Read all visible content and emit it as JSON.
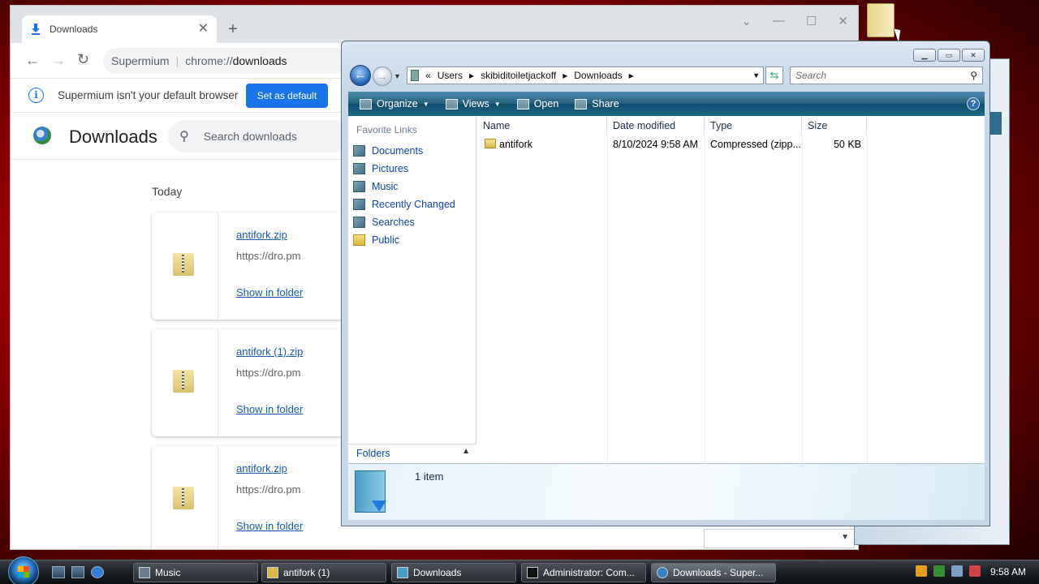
{
  "browser": {
    "tab_title": "Downloads",
    "omnibox_site": "Supermium",
    "omnibox_url_scheme": "chrome://",
    "omnibox_url_host": "downloads",
    "infobar_text": "Supermium isn't your default browser",
    "set_default_label": "Set as default",
    "page_title": "Downloads",
    "search_placeholder": "Search downloads",
    "section_today": "Today",
    "downloads": [
      {
        "file": "antifork.zip",
        "source": "https://dro.pm",
        "action": "Show in folder"
      },
      {
        "file": "antifork (1).zip",
        "source": "https://dro.pm",
        "action": "Show in folder"
      },
      {
        "file": "antifork.zip",
        "source": "https://dro.pm",
        "action": "Show in folder"
      }
    ]
  },
  "explorer": {
    "breadcrumb": {
      "prefix": "«",
      "parts": [
        "Users",
        "skibiditoiletjackoff",
        "Downloads"
      ]
    },
    "search_placeholder": "Search",
    "toolbar": {
      "organize": "Organize",
      "views": "Views",
      "open": "Open",
      "share": "Share",
      "help": "?"
    },
    "favorite_links_heading": "Favorite Links",
    "favorite_links": [
      "Documents",
      "Pictures",
      "Music",
      "Recently Changed",
      "Searches",
      "Public"
    ],
    "folders_label": "Folders",
    "columns": {
      "name": "Name",
      "date": "Date modified",
      "type": "Type",
      "size": "Size"
    },
    "files": [
      {
        "name": "antifork",
        "date": "8/10/2024 9:58 AM",
        "type": "Compressed (zipp...",
        "size": "50 KB"
      }
    ],
    "details_text": "1 item"
  },
  "taskbar": {
    "tasks": [
      "Music",
      "antifork (1)",
      "Downloads",
      "Administrator: Com...",
      "Downloads - Super..."
    ],
    "clock": "9:58 AM"
  },
  "colors": {
    "accent": "#1a73e8",
    "link": "#1a5bb8",
    "vista_toolbar": "#1d6a8b"
  }
}
